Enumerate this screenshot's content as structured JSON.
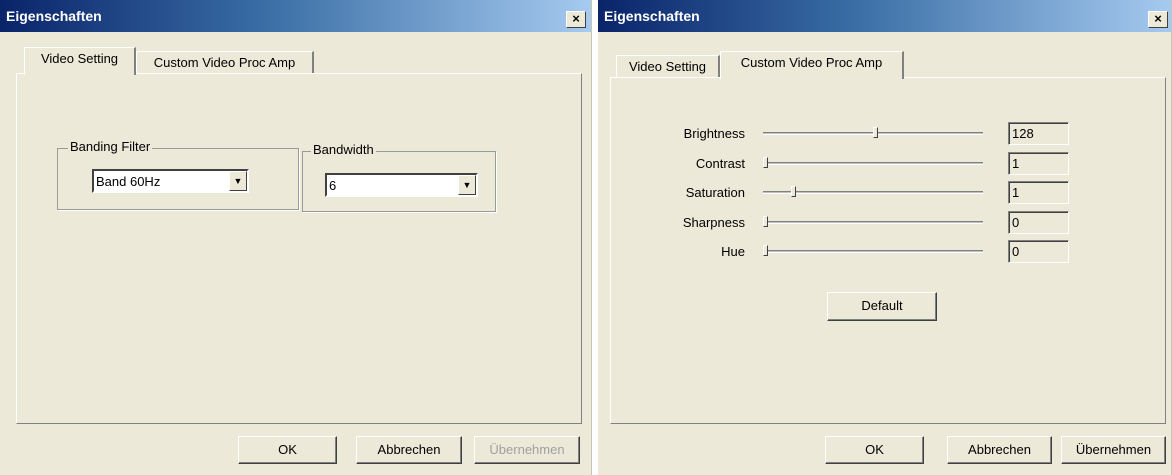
{
  "left": {
    "title": "Eigenschaften",
    "close": "×",
    "tabs": [
      "Video Setting",
      "Custom Video Proc Amp"
    ],
    "banding_filter": {
      "label": "Banding Filter",
      "value": "Band 60Hz"
    },
    "bandwidth": {
      "label": "Bandwidth",
      "value": "6"
    },
    "buttons": {
      "ok": "OK",
      "cancel": "Abbrechen",
      "apply": "Übernehmen"
    }
  },
  "right": {
    "title": "Eigenschaften",
    "close": "×",
    "tabs": [
      "Video Setting",
      "Custom Video Proc Amp"
    ],
    "sliders": [
      {
        "label": "Brightness",
        "value": "128",
        "level": 0.51
      },
      {
        "label": "Contrast",
        "value": "1",
        "level": 0.0
      },
      {
        "label": "Saturation",
        "value": "1",
        "level": 0.13
      },
      {
        "label": "Sharpness",
        "value": "0",
        "level": 0.0
      },
      {
        "label": "Hue",
        "value": "0",
        "level": 0.0
      }
    ],
    "default_label": "Default",
    "buttons": {
      "ok": "OK",
      "cancel": "Abbrechen",
      "apply": "Übernehmen"
    }
  }
}
